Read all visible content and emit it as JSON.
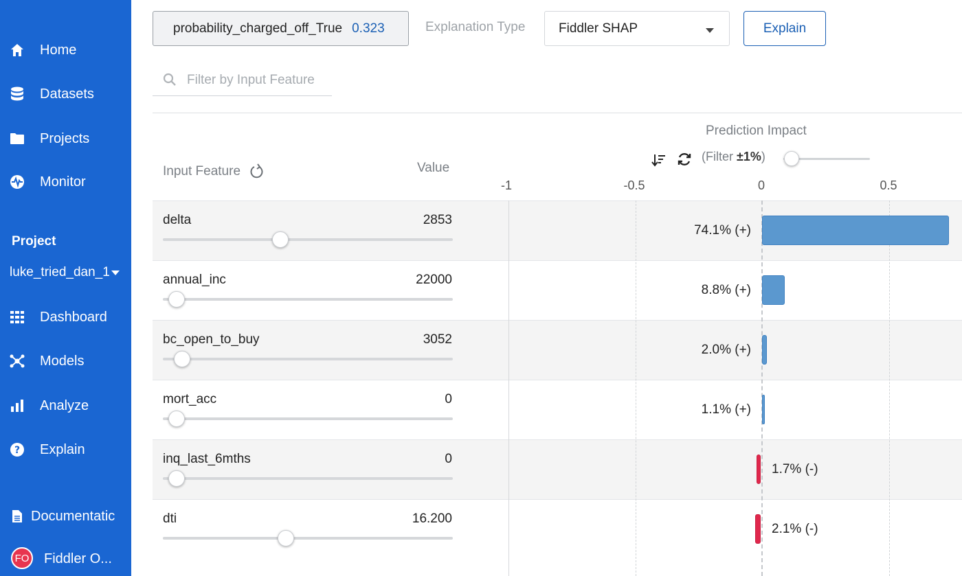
{
  "sidebar": {
    "nav": [
      {
        "label": "Home",
        "icon": "home-icon"
      },
      {
        "label": "Datasets",
        "icon": "database-icon"
      },
      {
        "label": "Projects",
        "icon": "folder-icon"
      },
      {
        "label": "Monitor",
        "icon": "monitor-icon"
      }
    ],
    "project_heading": "Project",
    "project_name": "luke_tried_dan_1",
    "project_nav": [
      {
        "label": "Dashboard",
        "icon": "grid-icon"
      },
      {
        "label": "Models",
        "icon": "network-icon"
      },
      {
        "label": "Analyze",
        "icon": "bar-chart-icon"
      },
      {
        "label": "Explain",
        "icon": "help-icon"
      }
    ],
    "documentation": "Documentatic",
    "avatar_initials": "FO",
    "user_name": "Fiddler O..."
  },
  "toolbar": {
    "output_name": "probability_charged_off_True",
    "output_value": "0.323",
    "explanation_type_label": "Explanation Type",
    "explanation_type_value": "Fiddler SHAP",
    "explain_button": "Explain"
  },
  "filter": {
    "placeholder": "Filter by Input Feature"
  },
  "table": {
    "input_feature_header": "Input Feature",
    "value_header": "Value",
    "impact_header": "Prediction Impact",
    "impact_filter_label": "(Filter ",
    "impact_filter_value": "±1%",
    "impact_filter_close": ")",
    "ticks": [
      "-1",
      "-0.5",
      "0",
      "0.5"
    ]
  },
  "chart_data": {
    "type": "bar",
    "orientation": "horizontal",
    "title": "Prediction Impact",
    "xlim": [
      -1,
      0.75
    ],
    "x_ticks": [
      -1,
      -0.5,
      0,
      0.5
    ],
    "categories": [
      "delta",
      "annual_inc",
      "bc_open_to_buy",
      "mort_acc",
      "inq_last_6mths",
      "dti"
    ],
    "values": [
      0.74,
      0.088,
      0.02,
      0.011,
      -0.017,
      -0.021
    ],
    "labels": [
      "74.1% (+)",
      "8.8% (+)",
      "2.0% (+)",
      "1.1% (+)",
      "1.7% (-)",
      "2.1% (-)"
    ],
    "colors": {
      "positive": "#5b98cf",
      "negative": "#e0274c"
    }
  },
  "rows": [
    {
      "name": "delta",
      "value": "2853",
      "slider": 0.4
    },
    {
      "name": "annual_inc",
      "value": "22000",
      "slider": 0.02
    },
    {
      "name": "bc_open_to_buy",
      "value": "3052",
      "slider": 0.04
    },
    {
      "name": "mort_acc",
      "value": "0",
      "slider": 0.02
    },
    {
      "name": "inq_last_6mths",
      "value": "0",
      "slider": 0.02
    },
    {
      "name": "dti",
      "value": "16.200",
      "slider": 0.42
    }
  ],
  "impact_filter_slider": 0.0
}
